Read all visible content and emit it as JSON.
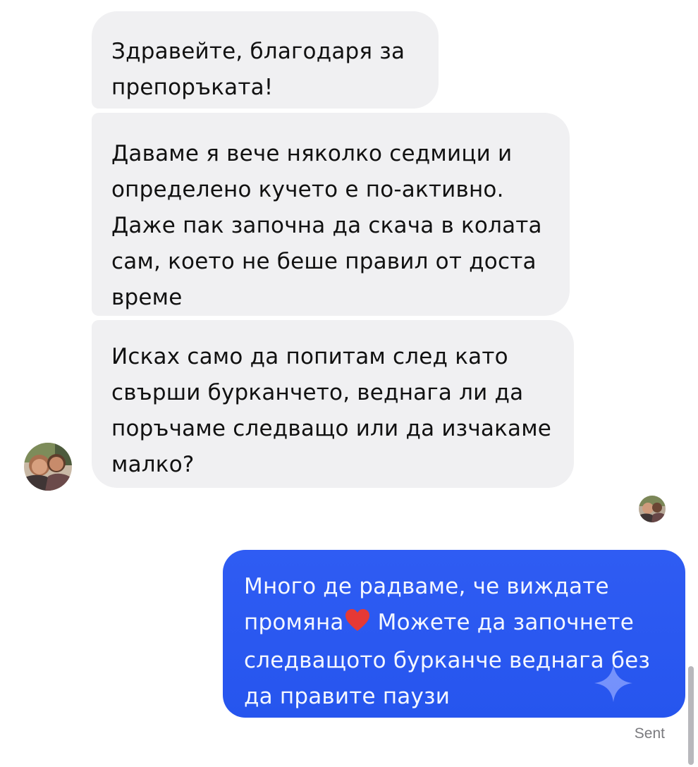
{
  "conversation": {
    "incoming_messages": [
      {
        "line1": "Здравейте, благодаря за",
        "line2": "препоръката!"
      },
      {
        "text": "Даваме я вече няколко седмици и определено кучето е по-активно. Даже пак започна да скача в колата сам, което не беше правил от доста време"
      },
      {
        "text": "Исках само да попитам след като свърши бурканчето, веднага ли да поръчаме следващо или да изчакаме малко?"
      }
    ],
    "outgoing_message": {
      "part1": "Много де радваме, че виждате промяна",
      "part2": " Можете да започнете следващото бурканче веднага без да правите паузи",
      "emoji": "heart-icon"
    },
    "status": "Sent"
  },
  "colors": {
    "incoming_bubble": "#f0f0f2",
    "outgoing_bubble": "#2f5cf3",
    "heart": "#e53935",
    "status_text": "#7a7a7e"
  }
}
